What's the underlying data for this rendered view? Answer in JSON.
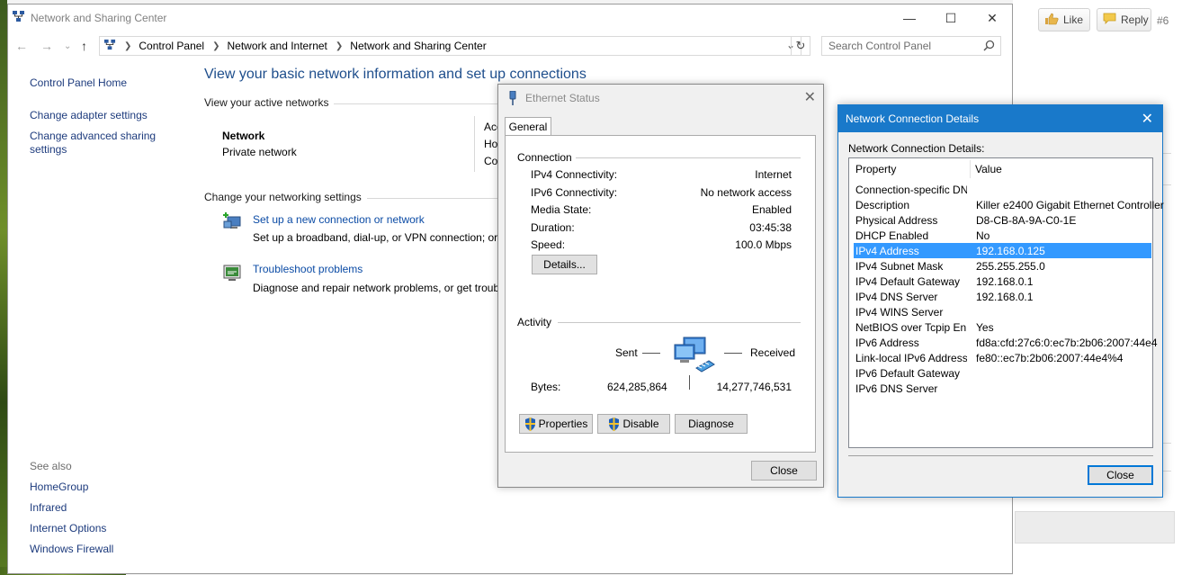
{
  "window": {
    "title": "Network and Sharing Center",
    "minimize": "—",
    "maximize": "☐",
    "close": "✕"
  },
  "address": {
    "crumbs": [
      "Control Panel",
      "Network and Internet",
      "Network and Sharing Center"
    ],
    "search_placeholder": "Search Control Panel"
  },
  "left_nav": {
    "home": "Control Panel Home",
    "change_adapter": "Change adapter settings",
    "change_sharing_line1": "Change advanced sharing",
    "change_sharing_line2": "settings",
    "see_also": "See also",
    "homegroup": "HomeGroup",
    "infrared": "Infrared",
    "internet_options": "Internet Options",
    "windows_firewall": "Windows Firewall"
  },
  "main": {
    "heading": "View your basic network information and set up connections",
    "active_networks_label": "View your active networks",
    "network_name": "Network",
    "network_type": "Private network",
    "access_type_fragment": "Acc",
    "homegroup_fragment": "Ho",
    "connections_fragment": "Co",
    "change_settings_label": "Change your networking settings",
    "setup_link": "Set up a new connection or network",
    "setup_desc": "Set up a broadband, dial-up, or VPN connection; or",
    "troubleshoot_link": "Troubleshoot problems",
    "troubleshoot_desc": "Diagnose and repair network problems, or get troub"
  },
  "ethernet_status": {
    "title": "Ethernet Status",
    "tab": "General",
    "connection_label": "Connection",
    "rows": [
      {
        "k": "IPv4 Connectivity:",
        "v": "Internet"
      },
      {
        "k": "IPv6 Connectivity:",
        "v": "No network access"
      },
      {
        "k": "Media State:",
        "v": "Enabled"
      },
      {
        "k": "Duration:",
        "v": "03:45:38"
      },
      {
        "k": "Speed:",
        "v": "100.0 Mbps"
      }
    ],
    "details_btn": "Details...",
    "activity_label": "Activity",
    "sent_label": "Sent",
    "received_label": "Received",
    "bytes_label": "Bytes:",
    "bytes_sent": "624,285,864",
    "bytes_received": "14,277,746,531",
    "properties_btn": "Properties",
    "disable_btn": "Disable",
    "diagnose_btn": "Diagnose",
    "close_btn": "Close"
  },
  "details_dialog": {
    "title": "Network Connection Details",
    "label": "Network Connection Details:",
    "col_property": "Property",
    "col_value": "Value",
    "rows": [
      {
        "p": "Connection-specific DN...",
        "v": ""
      },
      {
        "p": "Description",
        "v": "Killer e2400 Gigabit Ethernet Controller"
      },
      {
        "p": "Physical Address",
        "v": "D8-CB-8A-9A-C0-1E"
      },
      {
        "p": "DHCP Enabled",
        "v": "No"
      },
      {
        "p": "IPv4 Address",
        "v": "192.168.0.125"
      },
      {
        "p": "IPv4 Subnet Mask",
        "v": "255.255.255.0"
      },
      {
        "p": "IPv4 Default Gateway",
        "v": "192.168.0.1"
      },
      {
        "p": "IPv4 DNS Server",
        "v": "192.168.0.1"
      },
      {
        "p": "IPv4 WINS Server",
        "v": ""
      },
      {
        "p": "NetBIOS over Tcpip En...",
        "v": "Yes"
      },
      {
        "p": "IPv6 Address",
        "v": "fd8a:cfd:27c6:0:ec7b:2b06:2007:44e4"
      },
      {
        "p": "Link-local IPv6 Address",
        "v": "fe80::ec7b:2b06:2007:44e4%4"
      },
      {
        "p": "IPv6 Default Gateway",
        "v": ""
      },
      {
        "p": "IPv6 DNS Server",
        "v": ""
      }
    ],
    "selected_row": "IPv4 Address",
    "close_btn": "Close"
  },
  "forum": {
    "like": "Like",
    "reply": "Reply",
    "number": "#6"
  },
  "colors": {
    "accent": "#1979ca",
    "selection": "#3399ff",
    "link": "#1d3b7d"
  }
}
